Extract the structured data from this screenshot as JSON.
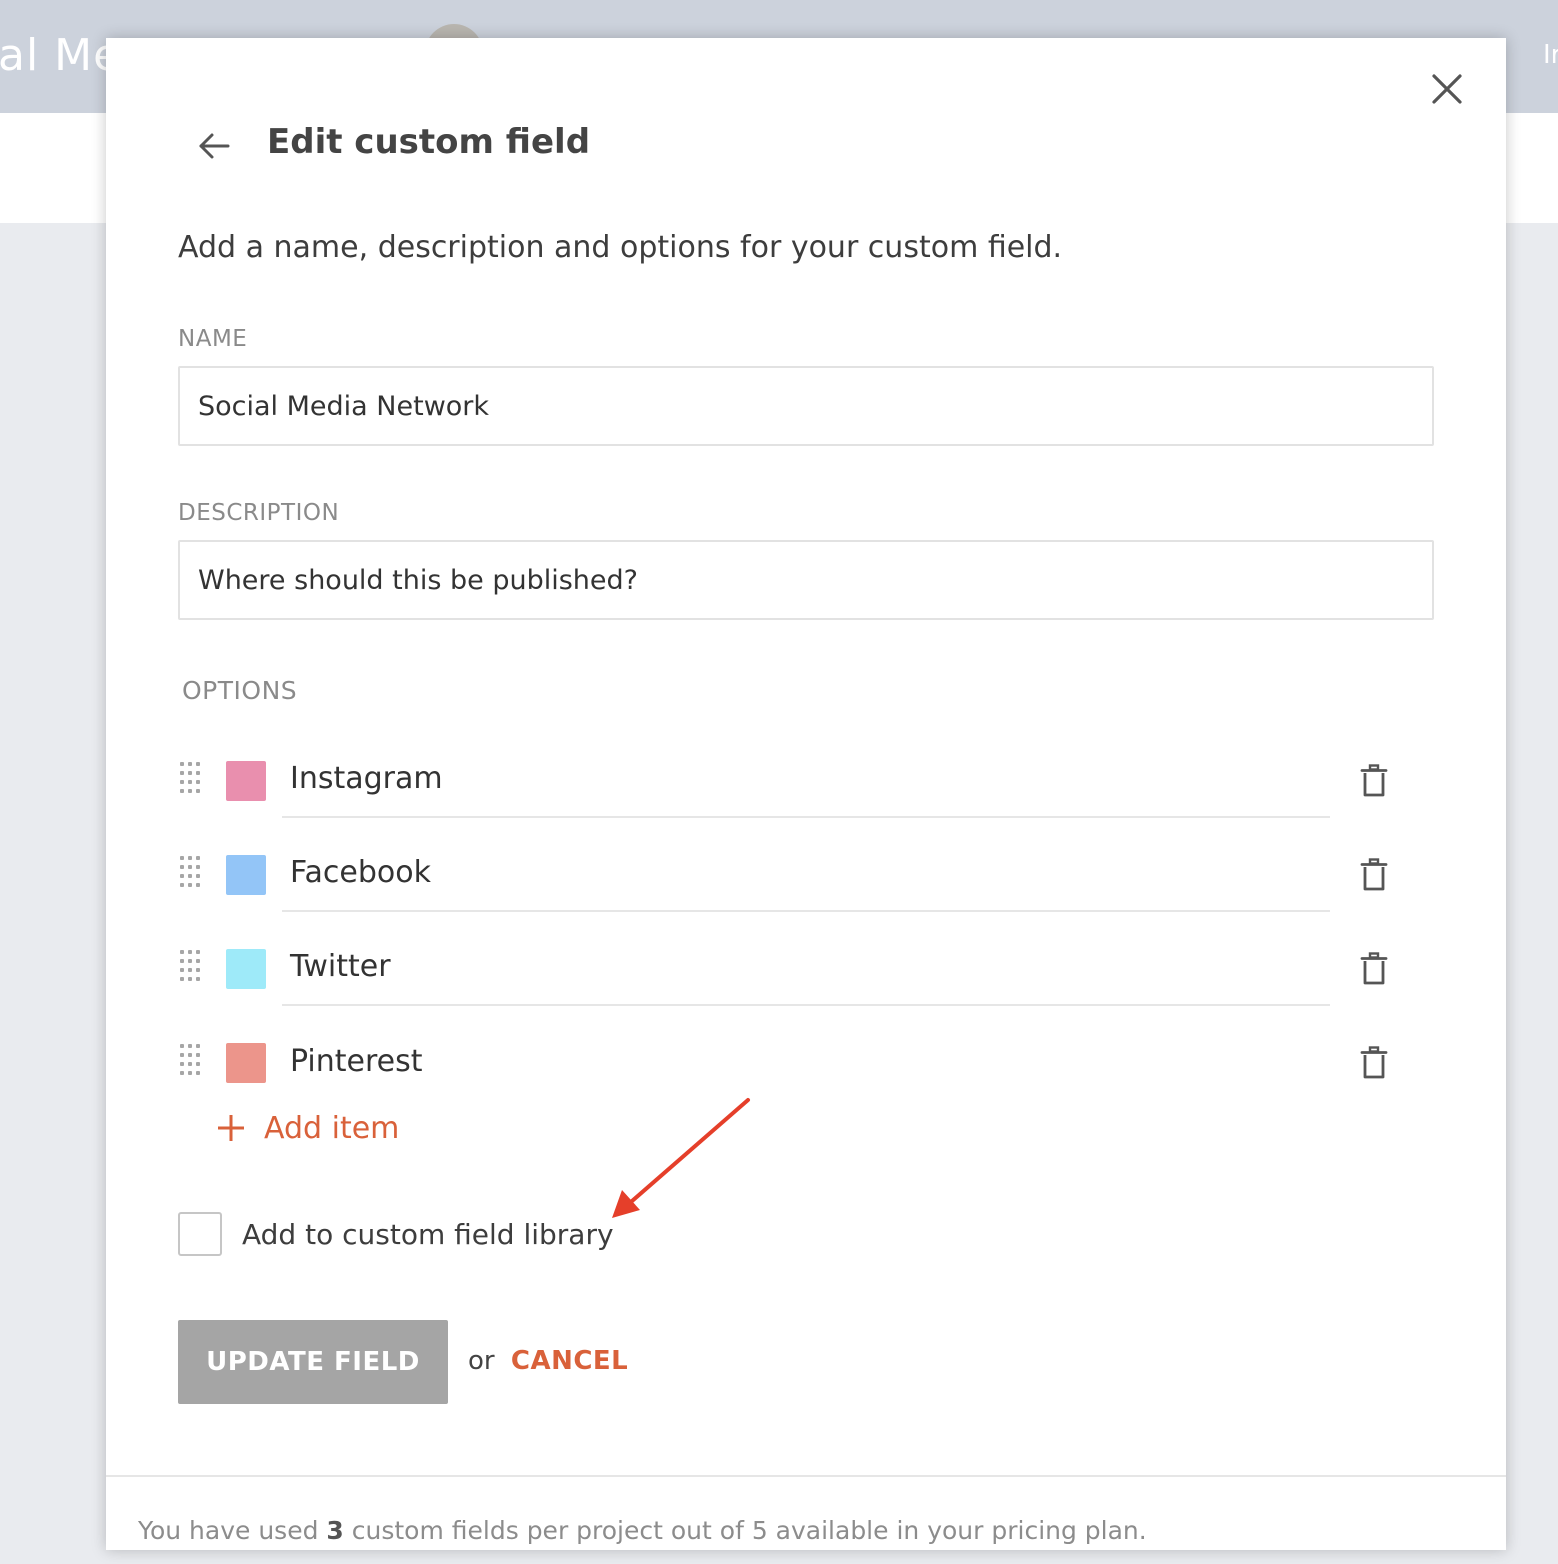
{
  "background": {
    "left_text": "al Me",
    "right_text": "Ir"
  },
  "modal": {
    "title": "Edit custom field",
    "subtitle": "Add a name, description and options for your custom field.",
    "name": {
      "label": "NAME",
      "value": "Social Media Network"
    },
    "description": {
      "label": "DESCRIPTION",
      "value": "Where should this be published?"
    },
    "options": {
      "label": "OPTIONS",
      "items": [
        {
          "label": "Instagram",
          "color": "#e98fae"
        },
        {
          "label": "Facebook",
          "color": "#93c5f7"
        },
        {
          "label": "Twitter",
          "color": "#9eeaf9"
        },
        {
          "label": "Pinterest",
          "color": "#ec958b"
        }
      ],
      "add_item_label": "Add item"
    },
    "library_checkbox": {
      "label": "Add to custom field library",
      "checked": false
    },
    "update_button": "UPDATE FIELD",
    "or_text": "or",
    "cancel_link": "CANCEL",
    "footer": {
      "prefix": "You have used",
      "used": "3",
      "suffix": "custom fields per project out of 5 available in your pricing plan."
    }
  },
  "colors": {
    "accent": "#d9613a",
    "annotation_arrow": "#e53f2a",
    "button_disabled": "#a5a5a5"
  }
}
